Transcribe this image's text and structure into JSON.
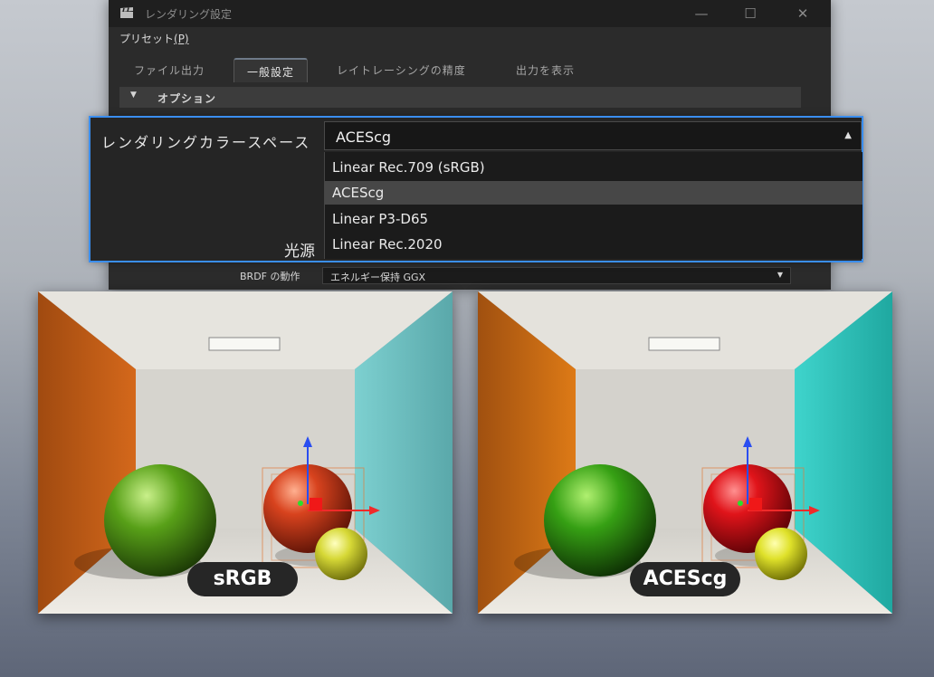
{
  "dialog": {
    "title": "レンダリング設定",
    "menu": {
      "preset_label": "プリセット",
      "preset_key": "(P)"
    },
    "tabs": [
      {
        "label": "ファイル出力",
        "active": false
      },
      {
        "label": "一般設定",
        "active": true
      },
      {
        "label": "レイトレーシングの精度",
        "active": false
      },
      {
        "label": "出力を表示",
        "active": false
      }
    ],
    "section": {
      "label": "オプション"
    },
    "brdf": {
      "label": "BRDF の動作",
      "value": "エネルギー保持 GGX"
    }
  },
  "color_space": {
    "label": "レンダリングカラースペース",
    "selected": "ACEScg",
    "options": [
      "Linear Rec.709 (sRGB)",
      "ACEScg",
      "Linear P3-D65",
      "Linear Rec.2020"
    ],
    "highlighted_index": 1,
    "light_source_label": "光源"
  },
  "renders": [
    {
      "badge": "sRGB",
      "left_wall": "#d4681b",
      "right_wall": "#7dd0d0",
      "red_sphere": "#d8431e",
      "green_sphere": "#58a018",
      "yellow_sphere": "#d6d836"
    },
    {
      "badge": "ACEScg",
      "left_wall": "#dd7a16",
      "right_wall": "#3fd4cc",
      "red_sphere": "#e0141a",
      "green_sphere": "#36a014",
      "yellow_sphere": "#dfe12a"
    }
  ],
  "colors": {
    "focus_border": "#3a8ef0",
    "dialog_bg": "#2b2b2b"
  }
}
